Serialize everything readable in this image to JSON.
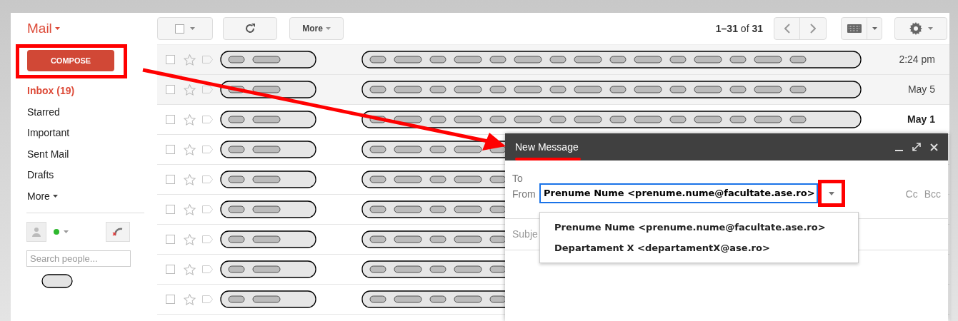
{
  "app": {
    "title": "Mail"
  },
  "toolbar": {
    "more_label": "More",
    "pagination": "**1–31** of **31**"
  },
  "sidebar": {
    "compose": "COMPOSE",
    "items": [
      {
        "label": "Inbox (19)",
        "selected": true,
        "kind": "folder"
      },
      {
        "label": "Starred",
        "selected": false,
        "kind": "folder"
      },
      {
        "label": "Important",
        "selected": false,
        "kind": "folder"
      },
      {
        "label": "Sent Mail",
        "selected": false,
        "kind": "folder"
      },
      {
        "label": "Drafts",
        "selected": false,
        "kind": "folder"
      },
      {
        "label": "More",
        "selected": false,
        "kind": "more"
      }
    ],
    "people_search": {
      "placeholder": "Search people..."
    }
  },
  "messages": [
    {
      "read": true,
      "time": "2:24 pm"
    },
    {
      "read": true,
      "time": "May 5"
    },
    {
      "read": false,
      "time": "May 1"
    },
    {
      "kind": "message"
    },
    {
      "kind": "message"
    },
    {
      "kind": "message"
    },
    {
      "kind": "message"
    },
    {
      "kind": "message"
    },
    {
      "kind": "message"
    }
  ],
  "compose": {
    "title": "New Message",
    "to_label": "To",
    "from_label": "From",
    "from_value": "Prenume Nume <prenume.nume@facultate.ase.ro>",
    "cc": "Cc",
    "bcc": "Bcc",
    "subject_label": "Subje",
    "from_options": [
      {
        "label": "Prenume Nume <prenume.nume@facultate.ase.ro>"
      },
      {
        "label": "Departament X <departamentX@ase.ro>"
      }
    ]
  }
}
